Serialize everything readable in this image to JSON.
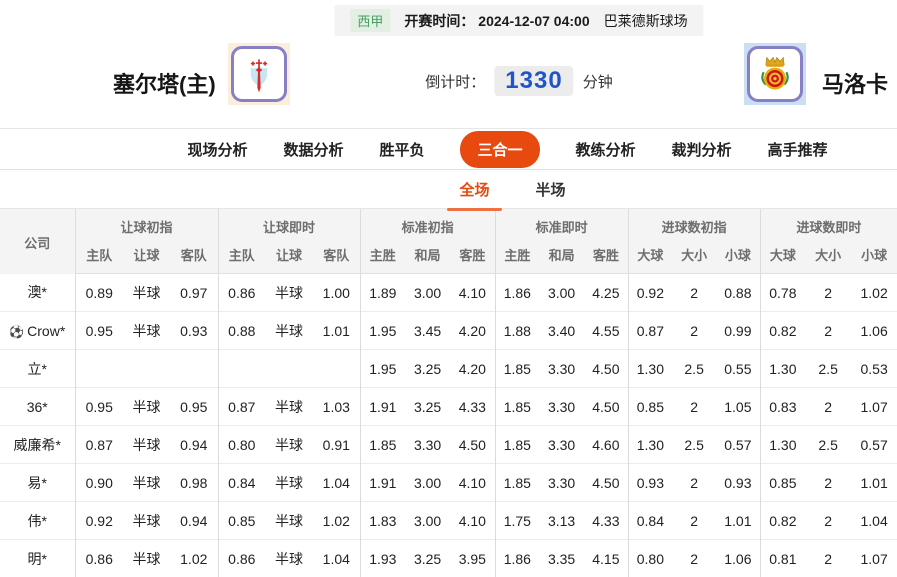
{
  "match": {
    "league": "西甲",
    "kickoff": "开赛时间： 2024-12-07 04:00",
    "venue": "巴莱德斯球场",
    "home_team": "塞尔塔(主)",
    "away_team": "马洛卡",
    "countdown_label": "倒计时：",
    "countdown_value": "1330",
    "countdown_unit": "分钟"
  },
  "nav_tabs": [
    {
      "key": "tab-live-analysis",
      "label": "现场分析",
      "active": false
    },
    {
      "key": "tab-data-analysis",
      "label": "数据分析",
      "active": false
    },
    {
      "key": "tab-win-draw-lose",
      "label": "胜平负",
      "active": false
    },
    {
      "key": "tab-three-in-one",
      "label": "三合一",
      "active": true
    },
    {
      "key": "tab-coach-analysis",
      "label": "教练分析",
      "active": false
    },
    {
      "key": "tab-referee-analysis",
      "label": "裁判分析",
      "active": false
    },
    {
      "key": "tab-expert-picks",
      "label": "高手推荐",
      "active": false
    }
  ],
  "sub_tabs": [
    {
      "key": "tab-full-match",
      "label": "全场",
      "active": true
    },
    {
      "key": "tab-half-match",
      "label": "半场",
      "active": false
    }
  ],
  "odds_table": {
    "company_header": "公司",
    "groups": [
      {
        "label": "让球初指",
        "cols": [
          "主队",
          "让球",
          "客队"
        ],
        "live": false
      },
      {
        "label": "让球即时",
        "cols": [
          "主队",
          "让球",
          "客队"
        ],
        "live": true
      },
      {
        "label": "标准初指",
        "cols": [
          "主胜",
          "和局",
          "客胜"
        ],
        "live": false
      },
      {
        "label": "标准即时",
        "cols": [
          "主胜",
          "和局",
          "客胜"
        ],
        "live": true
      },
      {
        "label": "进球数初指",
        "cols": [
          "大球",
          "大小",
          "小球"
        ],
        "live": false
      },
      {
        "label": "进球数即时",
        "cols": [
          "大球",
          "大小",
          "小球"
        ],
        "live": true
      }
    ],
    "rows": [
      {
        "company": "澳*",
        "icon": null,
        "cells": [
          [
            "0.89",
            "半球",
            "0.97"
          ],
          [
            "0.86",
            "半球",
            "1.00"
          ],
          [
            "1.89",
            "3.00",
            "4.10"
          ],
          [
            "1.86",
            "3.00",
            "4.25"
          ],
          [
            "0.92",
            "2",
            "0.88"
          ],
          [
            "0.78",
            "2",
            "1.02"
          ]
        ]
      },
      {
        "company": "Crow*",
        "icon": "soccer-ball-icon",
        "icon_glyph": "⚽",
        "cells": [
          [
            "0.95",
            "半球",
            "0.93"
          ],
          [
            "0.88",
            "半球",
            "1.01"
          ],
          [
            "1.95",
            "3.45",
            "4.20"
          ],
          [
            "1.88",
            "3.40",
            "4.55"
          ],
          [
            "0.87",
            "2",
            "0.99"
          ],
          [
            "0.82",
            "2",
            "1.06"
          ]
        ]
      },
      {
        "company": "立*",
        "icon": null,
        "cells": [
          [
            "",
            "",
            ""
          ],
          [
            "",
            "",
            ""
          ],
          [
            "1.95",
            "3.25",
            "4.20"
          ],
          [
            "1.85",
            "3.30",
            "4.50"
          ],
          [
            "1.30",
            "2.5",
            "0.55"
          ],
          [
            "1.30",
            "2.5",
            "0.53"
          ]
        ]
      },
      {
        "company": "36*",
        "icon": null,
        "cells": [
          [
            "0.95",
            "半球",
            "0.95"
          ],
          [
            "0.87",
            "半球",
            "1.03"
          ],
          [
            "1.91",
            "3.25",
            "4.33"
          ],
          [
            "1.85",
            "3.30",
            "4.50"
          ],
          [
            "0.85",
            "2",
            "1.05"
          ],
          [
            "0.83",
            "2",
            "1.07"
          ]
        ]
      },
      {
        "company": "威廉希*",
        "icon": null,
        "cells": [
          [
            "0.87",
            "半球",
            "0.94"
          ],
          [
            "0.80",
            "半球",
            "0.91"
          ],
          [
            "1.85",
            "3.30",
            "4.50"
          ],
          [
            "1.85",
            "3.30",
            "4.60"
          ],
          [
            "1.30",
            "2.5",
            "0.57"
          ],
          [
            "1.30",
            "2.5",
            "0.57"
          ]
        ]
      },
      {
        "company": "易*",
        "icon": null,
        "cells": [
          [
            "0.90",
            "半球",
            "0.98"
          ],
          [
            "0.84",
            "半球",
            "1.04"
          ],
          [
            "1.91",
            "3.00",
            "4.10"
          ],
          [
            "1.85",
            "3.30",
            "4.50"
          ],
          [
            "0.93",
            "2",
            "0.93"
          ],
          [
            "0.85",
            "2",
            "1.01"
          ]
        ]
      },
      {
        "company": "伟*",
        "icon": null,
        "cells": [
          [
            "0.92",
            "半球",
            "0.94"
          ],
          [
            "0.85",
            "半球",
            "1.02"
          ],
          [
            "1.83",
            "3.00",
            "4.10"
          ],
          [
            "1.75",
            "3.13",
            "4.33"
          ],
          [
            "0.84",
            "2",
            "1.01"
          ],
          [
            "0.82",
            "2",
            "1.04"
          ]
        ]
      },
      {
        "company": "明*",
        "icon": null,
        "cells": [
          [
            "0.86",
            "半球",
            "1.02"
          ],
          [
            "0.86",
            "半球",
            "1.04"
          ],
          [
            "1.93",
            "3.25",
            "3.95"
          ],
          [
            "1.86",
            "3.35",
            "4.15"
          ],
          [
            "0.80",
            "2",
            "1.06"
          ],
          [
            "0.81",
            "2",
            "1.07"
          ]
        ]
      }
    ]
  },
  "colors": {
    "accent_orange": "#e8490f",
    "live_blue": "#3060c4",
    "league_green": "#4a9e63",
    "countdown_blue": "#1e56c8",
    "header_gray_bg": "#f4f4f4"
  }
}
